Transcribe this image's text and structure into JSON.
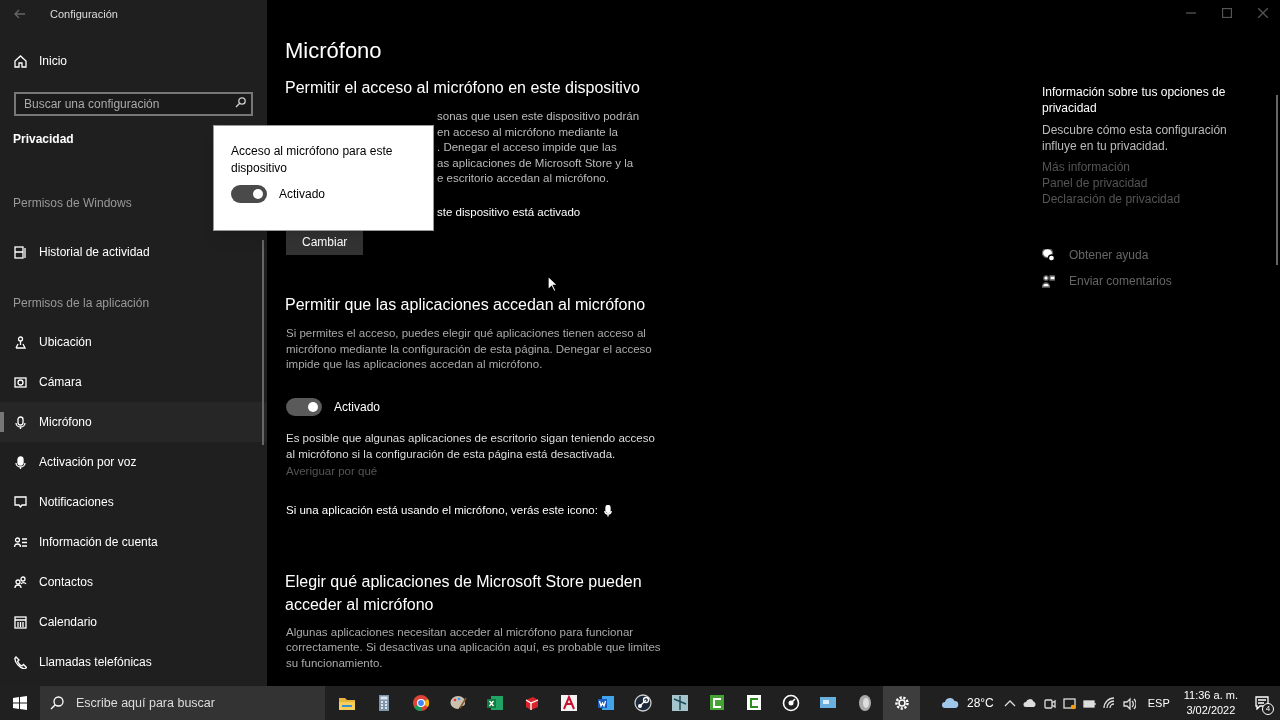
{
  "window": {
    "title": "Configuración"
  },
  "sidebar": {
    "home": "Inicio",
    "search_placeholder": "Buscar una configuración",
    "category": "Privacidad",
    "sections": [
      {
        "heading": "Permisos de Windows",
        "items": [
          {
            "label": "Historial de actividad",
            "selected": false
          }
        ]
      },
      {
        "heading": "Permisos de la aplicación",
        "items": [
          {
            "label": "Ubicación",
            "selected": false
          },
          {
            "label": "Cámara",
            "selected": false
          },
          {
            "label": "Micrófono",
            "selected": true
          },
          {
            "label": "Activación por voz",
            "selected": false
          },
          {
            "label": "Notificaciones",
            "selected": false
          },
          {
            "label": "Información de cuenta",
            "selected": false
          },
          {
            "label": "Contactos",
            "selected": false
          },
          {
            "label": "Calendario",
            "selected": false
          },
          {
            "label": "Llamadas telefónicas",
            "selected": false
          }
        ]
      }
    ]
  },
  "main": {
    "title": "Micrófono",
    "device": {
      "heading": "Permitir el acceso al micrófono en este dispositivo",
      "paragraph": "sonas que usen este dispositivo podrán\nen acceso al micrófono mediante la\n. Denegar el acceso impide que las\nas aplicaciones de Microsoft Store y la\ne escritorio accedan al micrófono.",
      "status": "ste dispositivo está activado",
      "button": "Cambiar"
    },
    "apps": {
      "heading": "Permitir que las aplicaciones accedan al micrófono",
      "paragraph": "Si permites el acceso, puedes elegir qué aplicaciones tienen acceso al micrófono mediante la configuración de esta página. Denegar el acceso impide que las aplicaciones accedan al micrófono.",
      "toggle": {
        "on": true,
        "label": "Activado"
      },
      "note": "Es posible que algunas aplicaciones de escritorio sigan teniendo acceso al micrófono si la configuración de esta página está desactivada.",
      "link": "Averiguar por qué",
      "icon_note": "Si una aplicación está usando el micrófono, verás este icono:"
    },
    "store": {
      "heading": "Elegir qué aplicaciones de Microsoft Store pueden acceder al micrófono",
      "paragraph": "Algunas aplicaciones necesitan acceder al micrófono para funcionar correctamente. Si desactivas una aplicación aquí, es probable que limites su funcionamiento."
    }
  },
  "popup": {
    "title": "Acceso al micrófono para este dispositivo",
    "toggle": {
      "on": true,
      "label": "Activado"
    }
  },
  "related": {
    "heading": "Información sobre tus opciones de privacidad",
    "text": "Descubre cómo esta configuración influye en tu privacidad.",
    "links": [
      "Más información",
      "Panel de privacidad",
      "Declaración de privacidad"
    ],
    "help": [
      "Obtener ayuda",
      "Enviar comentarios"
    ]
  },
  "taskbar": {
    "search_placeholder": "Escribe aquí para buscar",
    "temperature": "28°C",
    "language": "ESP",
    "time": "11:36 a. m.",
    "date": "3/02/2022",
    "notifications": "4"
  }
}
